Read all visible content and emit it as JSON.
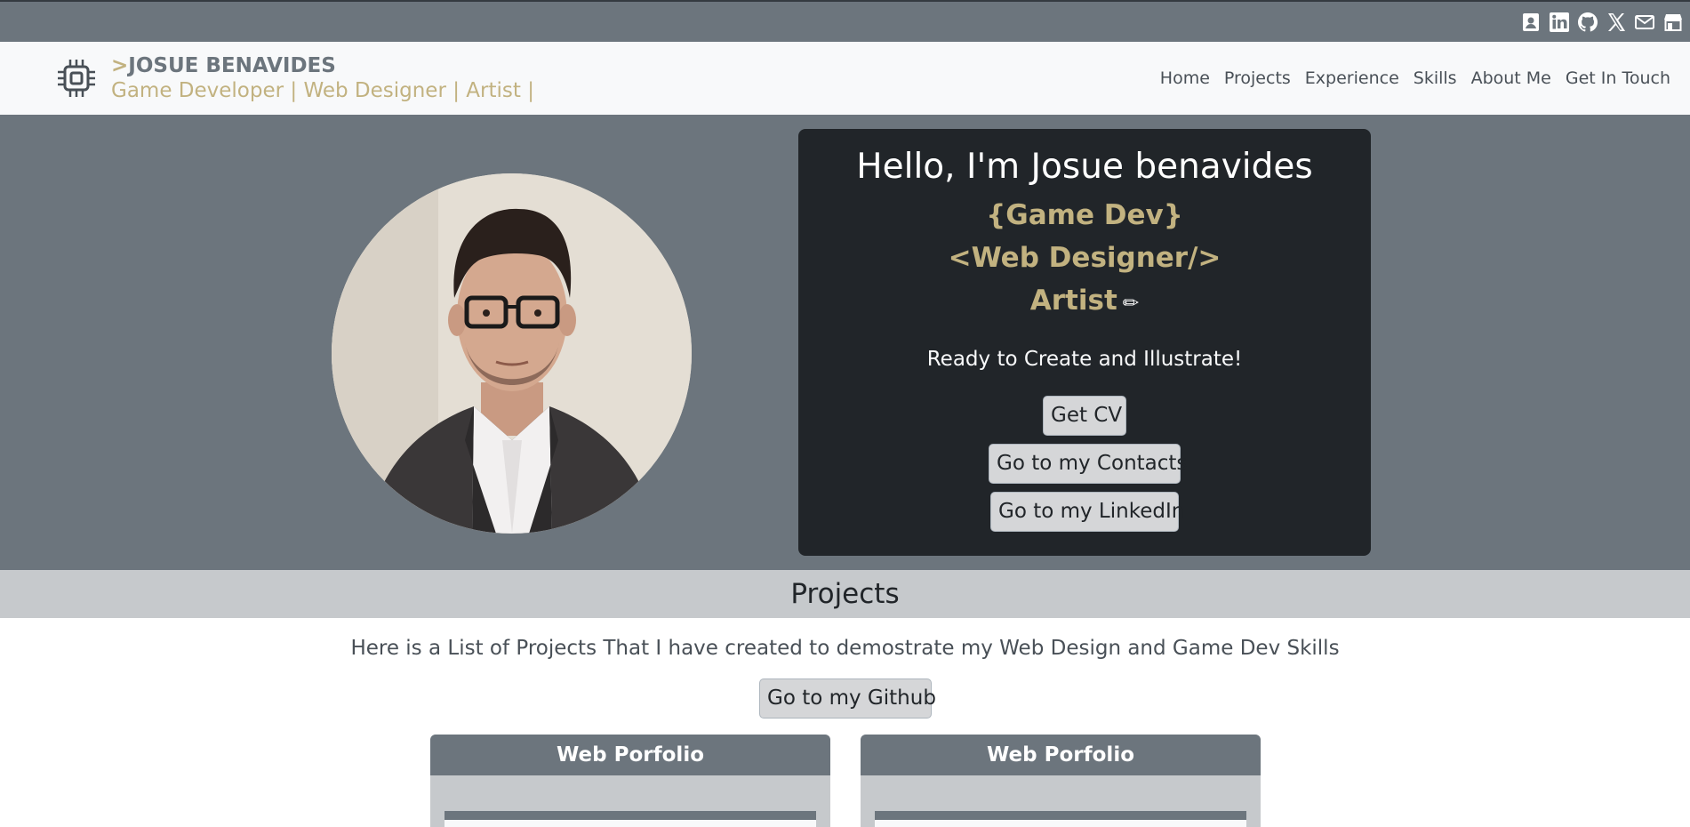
{
  "social": {
    "icons": [
      "contact-card-icon",
      "linkedin-icon",
      "github-icon",
      "x-icon",
      "mail-icon",
      "store-icon"
    ]
  },
  "navbar": {
    "brand_prefix": ">",
    "brand_name": "JOSUE BENAVIDES",
    "tagline": "Game Developer | Web Designer | Artist |",
    "links": [
      "Home",
      "Projects",
      "Experience",
      "Skills",
      "About Me",
      "Get In Touch"
    ]
  },
  "hero": {
    "greeting": "Hello, I'm Josue benavides",
    "roles": [
      "{Game Dev}",
      "<Web Designer/>",
      "Artist"
    ],
    "tagline": "Ready to Create and Illustrate!",
    "buttons": {
      "cv": "Get CV",
      "contacts": "Go to my Contacts",
      "linkedin": "Go to my LinkedIn"
    }
  },
  "projects": {
    "title": "Projects",
    "description": "Here is a List of Projects That I have created to demostrate my Web Design and Game Dev Skills",
    "github_button": "Go to my Github",
    "cards": [
      {
        "title": "Web Porfolio"
      },
      {
        "title": "Web Porfolio"
      }
    ]
  },
  "colors": {
    "accent": "#c2b280",
    "gray": "#6c757d",
    "dark": "#212529",
    "light": "#f8f9fa"
  }
}
